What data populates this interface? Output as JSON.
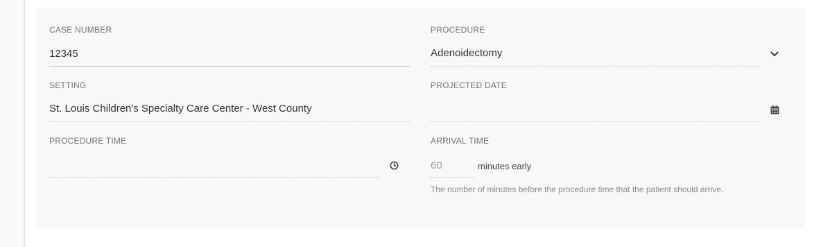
{
  "form": {
    "case_number": {
      "label": "CASE NUMBER",
      "value": "12345"
    },
    "procedure": {
      "label": "PROCEDURE",
      "value": "Adenoidectomy",
      "icon": "chevron-down-icon"
    },
    "setting": {
      "label": "SETTING",
      "value": "St. Louis Children's Specialty Care Center - West County"
    },
    "projected_date": {
      "label": "PROJECTED DATE",
      "value": "",
      "icon": "calendar-icon"
    },
    "procedure_time": {
      "label": "PROCEDURE TIME",
      "value": "",
      "icon": "clock-icon"
    },
    "arrival_time": {
      "label": "ARRIVAL TIME",
      "value": "60",
      "suffix": "minutes early",
      "hint": "The number of minutes before the procedure time that the patient should arrive."
    }
  },
  "colors": {
    "panel_background": "#f8f8f8",
    "label_text": "#757575",
    "value_text": "#333333",
    "hint_text": "#8a8a8a"
  }
}
